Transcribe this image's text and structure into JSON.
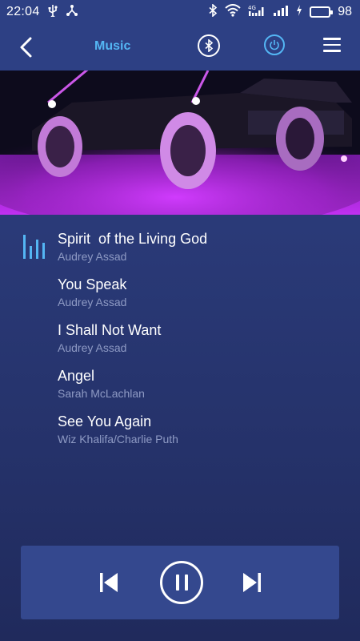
{
  "status_bar": {
    "time": "22:04",
    "battery_level": "98",
    "icons": [
      "usb-icon",
      "share-icon",
      "bluetooth-icon",
      "wifi-icon",
      "4g-signal-icon",
      "signal-icon",
      "charging-icon",
      "battery-icon"
    ]
  },
  "header": {
    "title": "Music",
    "title_color": "#54b6f4",
    "icons": [
      "back-icon",
      "bluetooth-icon",
      "power-icon",
      "menu-icon"
    ]
  },
  "playlist": {
    "now_playing_index": 0,
    "songs": [
      {
        "title": "Spirit  of the Living God",
        "artist": "Audrey Assad"
      },
      {
        "title": "You Speak",
        "artist": "Audrey Assad"
      },
      {
        "title": "I Shall Not Want",
        "artist": "Audrey Assad"
      },
      {
        "title": "Angel",
        "artist": "Sarah McLachlan"
      },
      {
        "title": "See You Again",
        "artist": "Wiz Khalifa/Charlie Puth"
      }
    ]
  },
  "player": {
    "state": "playing",
    "controls": [
      "previous-icon",
      "pause-icon",
      "next-icon"
    ]
  },
  "colors": {
    "accent": "#54b6f4",
    "header_bg": "#2d4084",
    "player_bg": "#34488e",
    "underglow": "#c026ff"
  }
}
